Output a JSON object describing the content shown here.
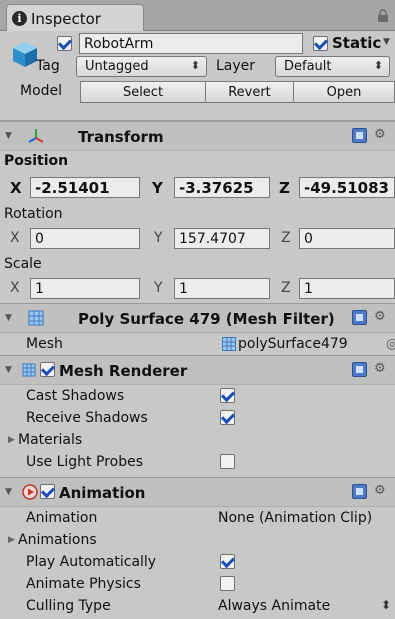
{
  "tab": {
    "label": "Inspector"
  },
  "gameobject": {
    "active": true,
    "name": "RobotArm",
    "static_checked": true,
    "static_label": "Static",
    "tag_label": "Tag",
    "tag_value": "Untagged",
    "layer_label": "Layer",
    "layer_value": "Default",
    "model_label": "Model",
    "select_label": "Select",
    "revert_label": "Revert",
    "open_label": "Open"
  },
  "transform": {
    "title": "Transform",
    "position_label": "Position",
    "rotation_label": "Rotation",
    "scale_label": "Scale",
    "axis_x": "X",
    "axis_y": "Y",
    "axis_z": "Z",
    "position": {
      "x": "-2.51401",
      "y": "-3.37625",
      "z": "-49.51083"
    },
    "rotation": {
      "x": "0",
      "y": "157.4707",
      "z": "0"
    },
    "scale": {
      "x": "1",
      "y": "1",
      "z": "1"
    }
  },
  "mesh_filter": {
    "title": "Poly Surface 479 (Mesh Filter)",
    "mesh_label": "Mesh",
    "mesh_value": "polySurface479"
  },
  "mesh_renderer": {
    "enabled": true,
    "title": "Mesh Renderer",
    "cast_shadows_label": "Cast Shadows",
    "cast_shadows": true,
    "receive_shadows_label": "Receive Shadows",
    "receive_shadows": true,
    "materials_label": "Materials",
    "use_light_probes_label": "Use Light Probes",
    "use_light_probes": false
  },
  "animation": {
    "enabled": true,
    "title": "Animation",
    "animation_label": "Animation",
    "animation_value": "None (Animation Clip)",
    "animations_label": "Animations",
    "play_automatically_label": "Play Automatically",
    "play_automatically": true,
    "animate_physics_label": "Animate Physics",
    "animate_physics": false,
    "culling_type_label": "Culling Type",
    "culling_type_value": "Always Animate"
  },
  "colors": {
    "panel_bg": "#c8c8c8",
    "header_bg": "#c0c0c0",
    "checkmark": "#1a4fb5"
  }
}
